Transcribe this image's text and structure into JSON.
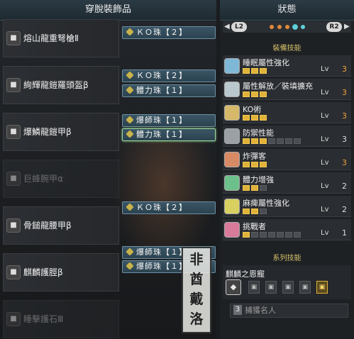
{
  "left": {
    "title": "穿脫裝飾品",
    "equipment": [
      {
        "name": "熔山龍重弩槍Ⅱ",
        "icon": "bowgun-icon",
        "dim": false
      },
      {
        "name": "絢輝龍鎧羅頭盔β",
        "icon": "helmet-icon",
        "dim": false
      },
      {
        "name": "爆鱗龍鎧甲β",
        "icon": "chest-armor-icon",
        "dim": false
      },
      {
        "name": "巨蜂腕甲α",
        "icon": "arm-armor-icon",
        "dim": true
      },
      {
        "name": "骨鎚龍腰甲β",
        "icon": "waist-armor-icon",
        "dim": false
      },
      {
        "name": "麒麟護脛β",
        "icon": "leg-armor-icon",
        "dim": false
      },
      {
        "name": "睡擊護石Ⅲ",
        "icon": "charm-icon",
        "dim": true
      }
    ],
    "decorations": [
      {
        "label": "ＫＯ珠【２】"
      },
      {
        "label": "ＫＯ珠【２】"
      },
      {
        "label": "體力珠【１】"
      },
      {
        "label": "爆師珠【１】"
      },
      {
        "label": "體力珠【１】",
        "selected": true
      },
      {
        "label": "ＫＯ珠【２】"
      },
      {
        "label": "爆師珠【１】"
      },
      {
        "label": "爆師珠【１】"
      }
    ],
    "stamp": [
      "非",
      "酋",
      "戴",
      "洛"
    ]
  },
  "right": {
    "title": "狀態",
    "tabs": {
      "left": "L2",
      "right": "R2"
    },
    "equip_skills_header": "裝備技能",
    "skills": [
      {
        "name": "睡眠屬性強化",
        "level": 3,
        "max": 3,
        "lv_label": "Lv",
        "icon_color": "#7fb8d6"
      },
      {
        "name": "屬性解放／裝填擴充",
        "level": 3,
        "max": 3,
        "lv_label": "Lv",
        "icon_color": "#b9c8cf"
      },
      {
        "name": "KO術",
        "level": 3,
        "max": 3,
        "lv_label": "Lv",
        "icon_color": "#d6b86a"
      },
      {
        "name": "防禦性能",
        "level": 3,
        "max": 7,
        "lv_label": "Lv",
        "icon_color": "#9aa0a6"
      },
      {
        "name": "炸彈客",
        "level": 3,
        "max": 3,
        "lv_label": "Lv",
        "icon_color": "#d78a63"
      },
      {
        "name": "體力增強",
        "level": 2,
        "max": 3,
        "lv_label": "Lv",
        "icon_color": "#6cc08a"
      },
      {
        "name": "麻痺屬性強化",
        "level": 2,
        "max": 3,
        "lv_label": "Lv",
        "icon_color": "#d8d060"
      },
      {
        "name": "挑戰者",
        "level": 1,
        "max": 7,
        "lv_label": "Lv",
        "icon_color": "#d87a9a"
      }
    ],
    "series_header": "系列技能",
    "series": {
      "name": "麒麟之恩寵",
      "active_index": 4
    },
    "bonus": {
      "count": "3",
      "name": "捕獲名人"
    }
  }
}
